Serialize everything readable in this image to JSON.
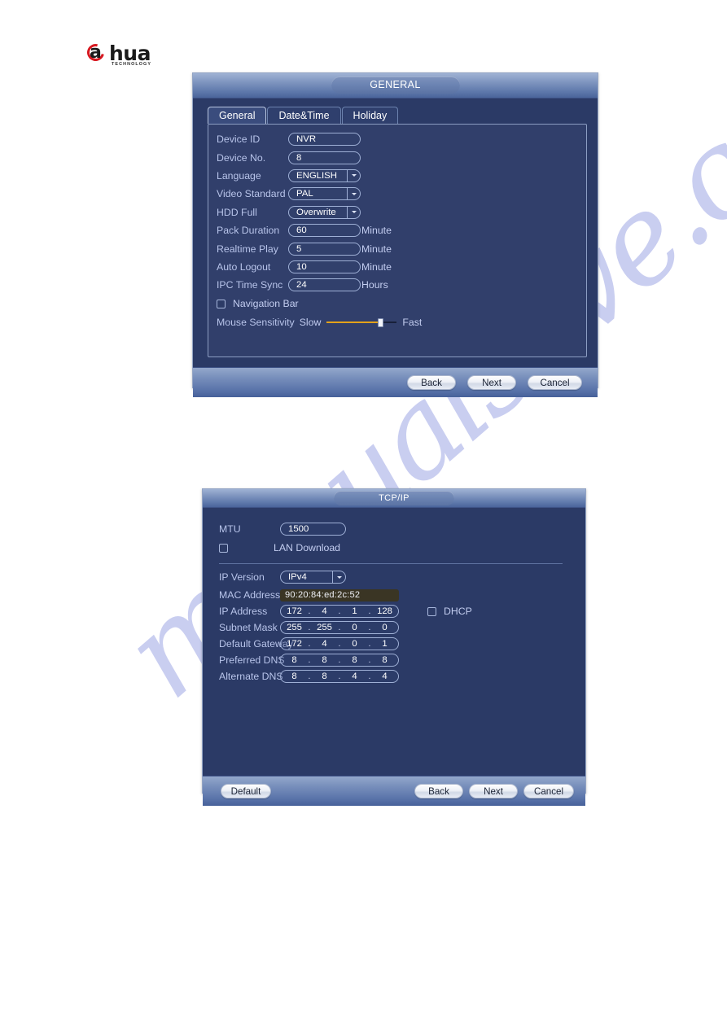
{
  "brand": {
    "logo_letter": "a",
    "logo_word": "hua",
    "logo_tagline": "TECHNOLOGY"
  },
  "watermark": {
    "text": "manualslive.com"
  },
  "general_dialog": {
    "title": "GENERAL",
    "tabs": [
      {
        "label": "General",
        "active": true
      },
      {
        "label": "Date&Time",
        "active": false
      },
      {
        "label": "Holiday",
        "active": false
      }
    ],
    "fields": [
      {
        "label": "Device ID",
        "value": "NVR",
        "unit": "",
        "type": "text"
      },
      {
        "label": "Device No.",
        "value": "8",
        "unit": "",
        "type": "text"
      },
      {
        "label": "Language",
        "value": "ENGLISH",
        "unit": "",
        "type": "select"
      },
      {
        "label": "Video Standard",
        "value": "PAL",
        "unit": "",
        "type": "select"
      },
      {
        "label": "HDD Full",
        "value": "Overwrite",
        "unit": "",
        "type": "select"
      },
      {
        "label": "Pack Duration",
        "value": "60",
        "unit": "Minute",
        "type": "text"
      },
      {
        "label": "Realtime Play",
        "value": "5",
        "unit": "Minute",
        "type": "text"
      },
      {
        "label": "Auto Logout",
        "value": "10",
        "unit": "Minute",
        "type": "text"
      },
      {
        "label": "IPC Time Sync",
        "value": "24",
        "unit": "Hours",
        "type": "text"
      }
    ],
    "navigation_bar": {
      "label": "Navigation Bar",
      "checked": false
    },
    "mouse_sensitivity": {
      "label": "Mouse Sensitivity",
      "min_label": "Slow",
      "max_label": "Fast",
      "value_percent": 74
    },
    "buttons": {
      "back": "Back",
      "next": "Next",
      "cancel": "Cancel"
    }
  },
  "tcpip_dialog": {
    "title": "TCP/IP",
    "mtu": {
      "label": "MTU",
      "value": "1500"
    },
    "lan_download": {
      "label": "LAN Download",
      "checked": false
    },
    "ip_version": {
      "label": "IP Version",
      "value": "IPv4"
    },
    "mac_address": {
      "label": "MAC Address",
      "value": "90:20:84:ed:2c:52"
    },
    "dhcp": {
      "label": "DHCP",
      "checked": false
    },
    "ip_fields": [
      {
        "label": "IP Address",
        "octets": [
          "172",
          "4",
          "1",
          "128"
        ]
      },
      {
        "label": "Subnet Mask",
        "octets": [
          "255",
          "255",
          "0",
          "0"
        ]
      },
      {
        "label": "Default Gateway",
        "octets": [
          "172",
          "4",
          "0",
          "1"
        ]
      },
      {
        "label": "Preferred DNS",
        "octets": [
          "8",
          "8",
          "8",
          "8"
        ]
      },
      {
        "label": "Alternate DNS",
        "octets": [
          "8",
          "8",
          "4",
          "4"
        ]
      }
    ],
    "buttons": {
      "default": "Default",
      "back": "Back",
      "next": "Next",
      "cancel": "Cancel"
    }
  },
  "colors": {
    "dialog_body": "#2b3a66",
    "panel": "#313f6b",
    "label_text": "#b8c4ea",
    "accent_slider": "#e3a21a",
    "mac_disabled_bg": "#3a3524",
    "brand_red": "#d71921"
  }
}
